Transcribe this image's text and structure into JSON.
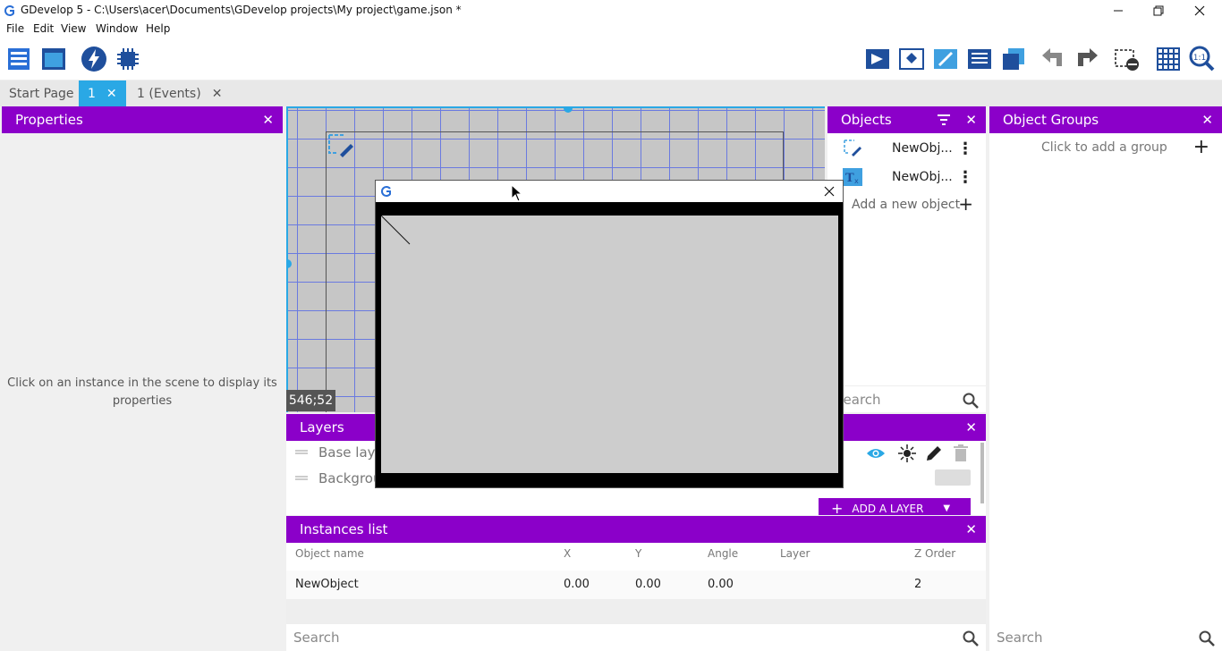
{
  "window": {
    "title": "GDevelop 5 - C:\\Users\\acer\\Documents\\GDevelop projects\\My project\\game.json *",
    "minimize": "—",
    "restore": "❐",
    "close": "✕"
  },
  "menu": [
    "File",
    "Edit",
    "View",
    "Window",
    "Help"
  ],
  "tabs": [
    {
      "label": "Start Page",
      "closable": false
    },
    {
      "label": "1",
      "closable": true,
      "active": true
    },
    {
      "label": "1 (Events)",
      "closable": true
    }
  ],
  "properties": {
    "title": "Properties",
    "empty_line1": "Click on an instance in the scene to display its",
    "empty_line2": "properties"
  },
  "scene": {
    "coords": "546;52"
  },
  "objects": {
    "title": "Objects",
    "items": [
      {
        "name": "NewObj...",
        "icon": "sprite-icon"
      },
      {
        "name": "NewObj...",
        "icon": "text-object-icon"
      }
    ],
    "add_label": "Add a new object",
    "search_placeholder": "Search"
  },
  "groups": {
    "title": "Object Groups",
    "hint": "Click to add a group",
    "search_placeholder": "Search"
  },
  "layers": {
    "title": "Layers",
    "items": [
      {
        "name": "Base layer"
      },
      {
        "name": "Background"
      }
    ],
    "add_label": "ADD A LAYER"
  },
  "instances": {
    "title": "Instances list",
    "columns": [
      "Object name",
      "X",
      "Y",
      "Angle",
      "Layer",
      "Z Order"
    ],
    "rows": [
      {
        "name": "NewObject",
        "x": "0.00",
        "y": "0.00",
        "angle": "0.00",
        "layer": "",
        "z": "2"
      }
    ],
    "search_placeholder": "Search"
  },
  "colors": {
    "accent_purple": "#8b00c9",
    "tab_active": "#2aa8e5",
    "grid": "#6a7ae0",
    "selection_blue": "#2aa8e5"
  }
}
